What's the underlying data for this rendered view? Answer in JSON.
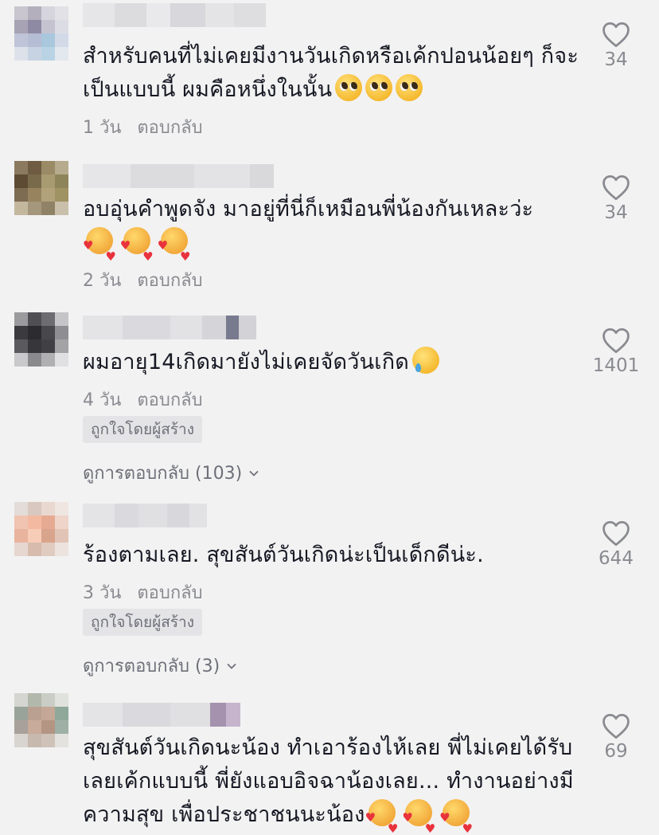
{
  "colors": {
    "background": "#f2f2f2",
    "text": "#161823",
    "meta": "#8a8b91",
    "badge_bg": "#e4e4e6"
  },
  "icons": {
    "like": "heart-outline-icon",
    "expand": "chevron-down-icon"
  },
  "comments": [
    {
      "text": "สำหรับคนที่ไม่เคยมีงานวันเกิดหรือเค้กปอนน้อยๆ ก็จะเป็นแบบนี้ ผมคือหนึ่งในนั้น",
      "emoji": [
        "pleading-face",
        "pleading-face",
        "pleading-face"
      ],
      "time": "1 วัน",
      "reply_label": "ตอบกลับ",
      "likes": "34"
    },
    {
      "text": "อบอุ่นคำพูดจัง มาอยู่ที่นี่ก็เหมือนพี่น้องกันเหละว่ะ",
      "emoji": [
        "smiling-face-with-hearts",
        "smiling-face-with-hearts",
        "smiling-face-with-hearts"
      ],
      "time": "2 วัน",
      "reply_label": "ตอบกลับ",
      "likes": "34"
    },
    {
      "text": "ผมอายุ14เกิดมายังไม่เคยจัดวันเกิด",
      "emoji": [
        "smiling-face-with-tear"
      ],
      "time": "4 วัน",
      "reply_label": "ตอบกลับ",
      "badge": "ถูกใจโดยผู้สร้าง",
      "view_replies": "ดูการตอบกลับ (103)",
      "likes": "1401"
    },
    {
      "text": "ร้องตามเลย. สุขสันต์วันเกิดน่ะเป็นเด็กดีน่ะ.",
      "emoji": [],
      "time": "3 วัน",
      "reply_label": "ตอบกลับ",
      "badge": "ถูกใจโดยผู้สร้าง",
      "view_replies": "ดูการตอบกลับ (3)",
      "likes": "644"
    },
    {
      "text": "สุขสันต์วันเกิดนะน้อง ทำเอาร้องไห้เลย พี่ไม่เคยได้รับเลยเค้กแบบนี้ พี่ยังแอบอิจฉาน้องเลย... ทำงานอย่างมีความสุข เพื่อประชาชนนะน้อง",
      "emoji": [
        "smiling-face-with-hearts",
        "smiling-face-with-hearts",
        "smiling-face-with-hearts"
      ],
      "likes": "69"
    }
  ]
}
